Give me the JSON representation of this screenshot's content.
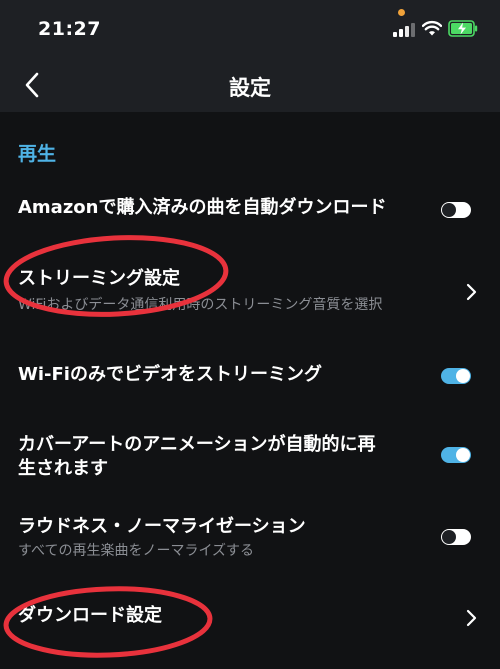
{
  "status_bar": {
    "time": "21:27",
    "privacy_dot_color": "#f0a23a",
    "battery_color": "#4cd964"
  },
  "nav": {
    "title": "設定",
    "back_icon": "chevron-left-icon"
  },
  "section": {
    "header": "再生",
    "header_color": "#4fb3e6"
  },
  "settings": {
    "auto_download": {
      "label": "Amazonで購入済みの曲を自動ダウンロード",
      "toggle_on": false
    },
    "streaming": {
      "label": "ストリーミング設定",
      "subtitle": "WiFiおよびデータ通信利用時のストリーミング音質を選択"
    },
    "wifi_video": {
      "label": "Wi-Fiのみでビデオをストリーミング",
      "toggle_on": true
    },
    "cover_art": {
      "label_line1": "カバーアートのアニメーションが自動的に再",
      "label_line2": "生されます",
      "toggle_on": true
    },
    "loudness": {
      "label": "ラウドネス・ノーマライゼーション",
      "subtitle": "すべての再生楽曲をノーマライズする",
      "toggle_on": false
    },
    "download": {
      "label": "ダウンロード設定"
    }
  },
  "colors": {
    "toggle_on_track": "#4fb3e6",
    "toggle_off_track": "#ffffff",
    "annotation_red": "#e8323c"
  }
}
